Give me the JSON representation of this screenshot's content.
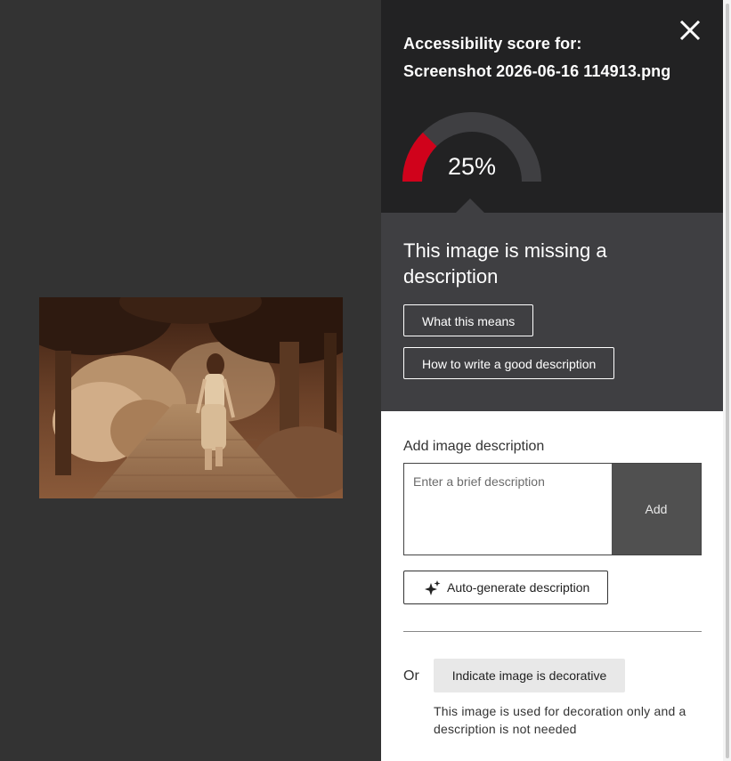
{
  "score": {
    "title_line1": "Accessibility score for:",
    "title_line2": "Screenshot 2026-06-16 114913.png",
    "percent": 25,
    "percent_label": "25%",
    "gauge_fill_color": "#d0021b",
    "gauge_track_color": "#3f3f42",
    "close_icon": "close-icon"
  },
  "notice": {
    "title": "This image is missing a description",
    "what_means_label": "What this means",
    "how_to_label": "How to write a good description"
  },
  "description": {
    "label": "Add image description",
    "placeholder": "Enter a brief description",
    "add_label": "Add",
    "auto_generate_label": "Auto-generate description",
    "auto_generate_icon": "sparkle-icon"
  },
  "decorative": {
    "or_label": "Or",
    "button_label": "Indicate image is decorative",
    "note": "This image is used for decoration only and a description is not needed"
  },
  "colors": {
    "preview_bg": "#333333",
    "header_bg": "#222223",
    "notice_bg": "#3f3f42",
    "add_button_bg": "#505050"
  }
}
